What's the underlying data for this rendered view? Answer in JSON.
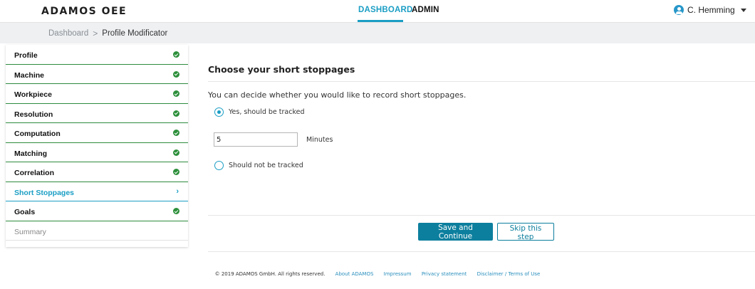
{
  "header": {
    "logo": "ADAMOS OEE",
    "nav": [
      {
        "label": "DASHBOARD",
        "active": true
      },
      {
        "label": "ADMIN",
        "active": false
      }
    ],
    "user_name": "C. Hemming",
    "accent": "#1a9ec4"
  },
  "breadcrumb": {
    "root": "Dashboard",
    "separator": ">",
    "current": "Profile Modificator"
  },
  "sidebar": {
    "items": [
      {
        "label": "Profile",
        "status": "done"
      },
      {
        "label": "Machine",
        "status": "done"
      },
      {
        "label": "Workpiece",
        "status": "done"
      },
      {
        "label": "Resolution",
        "status": "done"
      },
      {
        "label": "Computation",
        "status": "done"
      },
      {
        "label": "Matching",
        "status": "done"
      },
      {
        "label": "Correlation",
        "status": "done"
      },
      {
        "label": "Short Stoppages",
        "status": "active"
      },
      {
        "label": "Goals",
        "status": "done"
      },
      {
        "label": "Summary",
        "status": "pending"
      }
    ],
    "done_color": "#2c8f3a"
  },
  "main": {
    "title": "Choose your short stoppages",
    "description": "You can decide whether you would like to record short stoppages.",
    "option_yes": "Yes, should be tracked",
    "option_no": "Should not be tracked",
    "selected": "yes",
    "minutes_value": "5",
    "minutes_label": "Minutes",
    "save_label": "Save and Continue",
    "skip_label": "Skip this step"
  },
  "footer": {
    "copyright": "© 2019 ADAMOS GmbH. All rights reserved.",
    "links": [
      "About ADAMOS",
      "Impressum",
      "Privacy statement",
      "Disclaimer / Terms of Use"
    ]
  }
}
